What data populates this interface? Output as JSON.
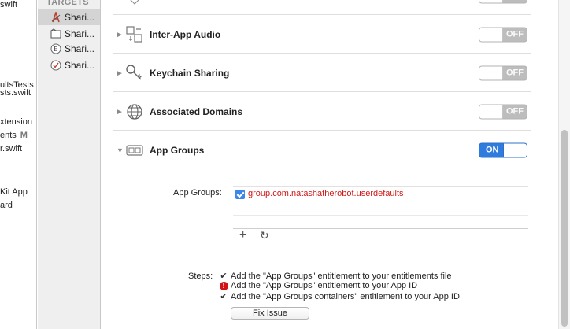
{
  "navigator": {
    "items": [
      {
        "text": "swift",
        "badge": ""
      },
      {
        "text": "ultsTests",
        "badge": ""
      },
      {
        "text": "sts.swift",
        "badge": ""
      },
      {
        "text": "xtension",
        "badge": ""
      },
      {
        "text": "ents",
        "badge": "M"
      },
      {
        "text": "r.swift",
        "badge": ""
      },
      {
        "text": "Kit App",
        "badge": ""
      },
      {
        "text": "ard",
        "badge": ""
      }
    ]
  },
  "targets": {
    "header": "TARGETS",
    "items": [
      {
        "label": "Shari...",
        "icon": "app-target-icon",
        "selected": true
      },
      {
        "label": "Shari...",
        "icon": "folder-target-icon",
        "selected": false
      },
      {
        "label": "Shari...",
        "icon": "extension-target-icon",
        "selected": false
      },
      {
        "label": "Shari...",
        "icon": "tests-target-icon",
        "selected": false
      }
    ]
  },
  "capabilities": [
    {
      "title": "Inter-App Audio",
      "state": "OFF",
      "icon": "inter-app-audio-icon"
    },
    {
      "title": "Keychain Sharing",
      "state": "OFF",
      "icon": "key-icon"
    },
    {
      "title": "Associated Domains",
      "state": "OFF",
      "icon": "globe-icon"
    },
    {
      "title": "App Groups",
      "state": "ON",
      "icon": "app-groups-icon"
    }
  ],
  "app_groups": {
    "label": "App Groups:",
    "entries": [
      {
        "id": "group.com.natashatherobot.userdefaults",
        "checked": true
      }
    ],
    "add_symbol": "+",
    "refresh_symbol": "↻"
  },
  "steps": {
    "label": "Steps:",
    "items": [
      {
        "text": "Add the \"App Groups\" entitlement to your entitlements file",
        "status": "done"
      },
      {
        "text": "Add the \"App Groups\" entitlement to your App ID",
        "status": "error"
      },
      {
        "text": "Add the \"App Groups containers\" entitlement to your App ID",
        "status": "done"
      }
    ],
    "fix_button": "Fix Issue"
  },
  "colors": {
    "toggle_on": "#2f7bde",
    "toggle_off": "#bdbdbd",
    "error": "#d41313",
    "group_id_text": "#d01818"
  }
}
